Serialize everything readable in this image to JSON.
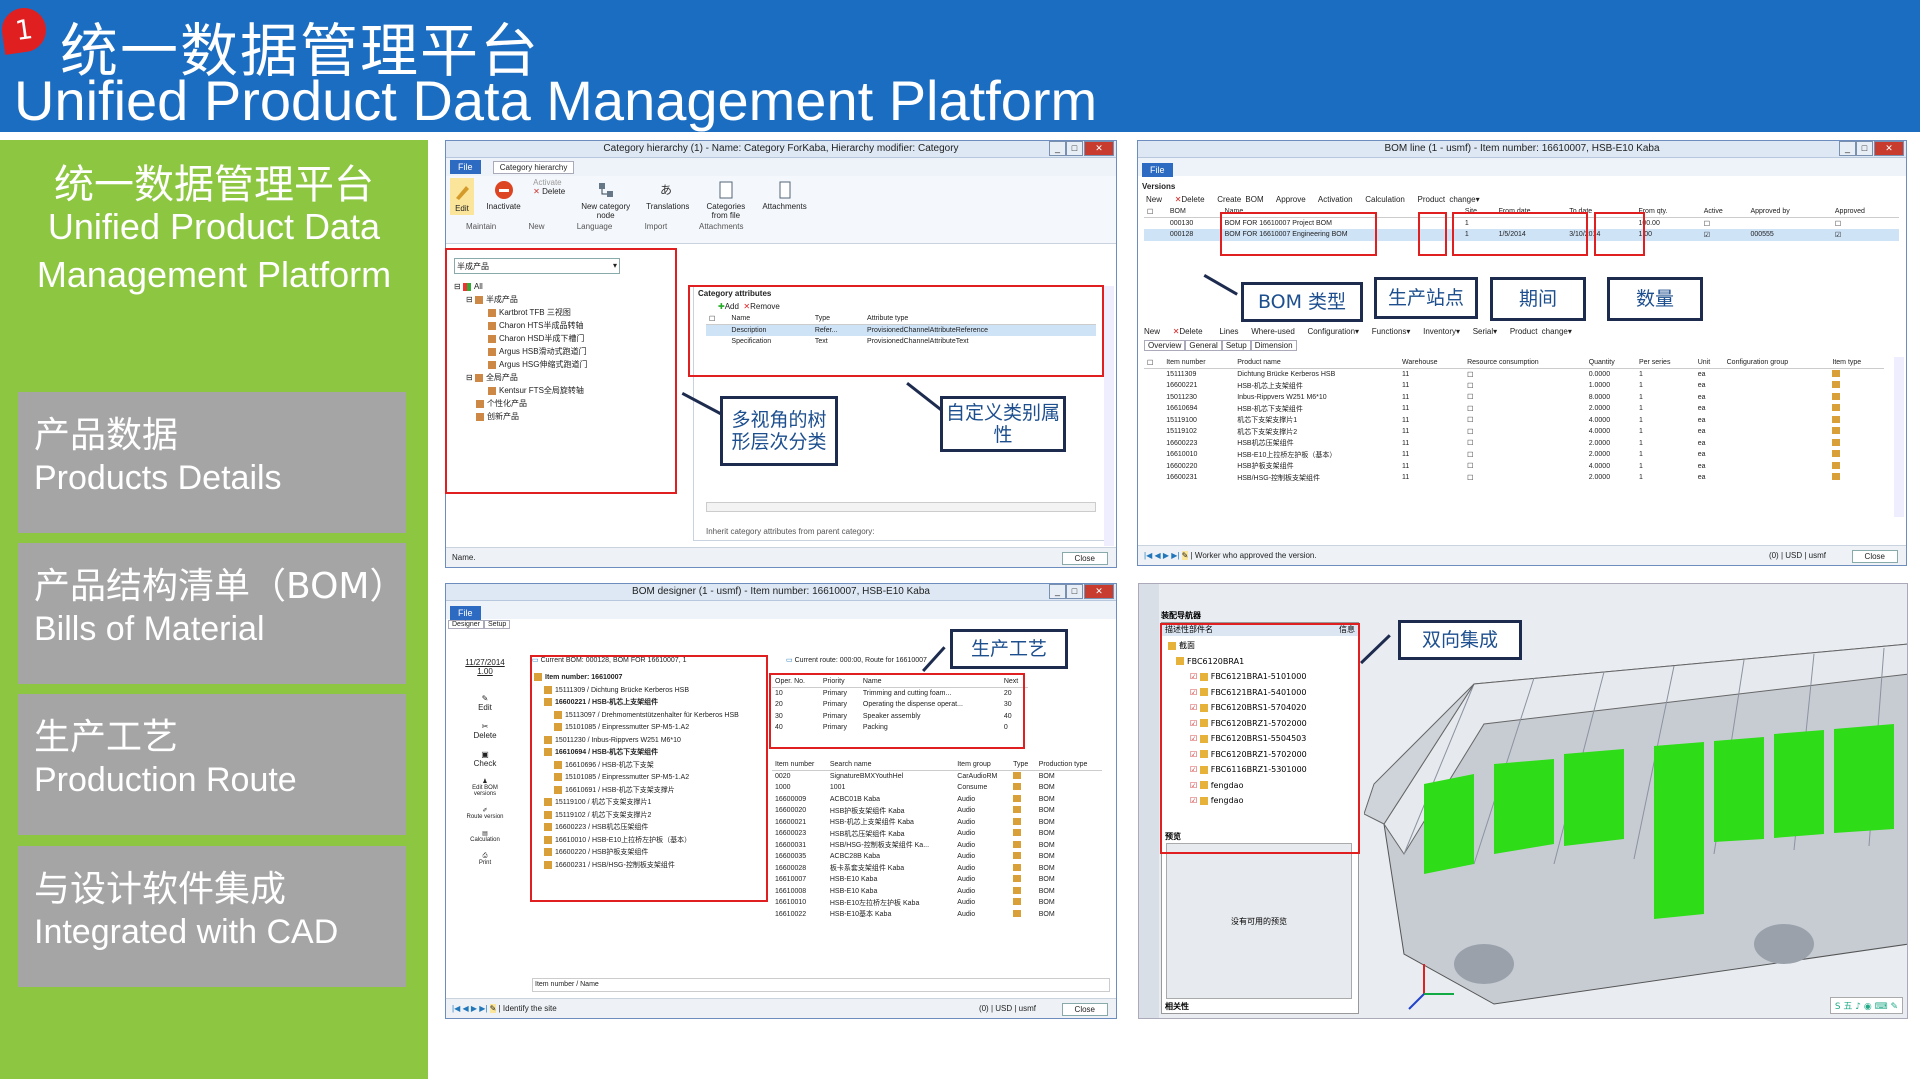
{
  "header": {
    "badge": "1",
    "title_cn": "统一数据管理平台",
    "title_en": "Unified Product Data Management Platform",
    "bg": "#1b6dc1"
  },
  "left": {
    "title_cn": "统一数据管理平台",
    "title_en1": "Unified Product Data",
    "title_en2": "Management Platform",
    "modules": [
      {
        "cn": "产品数据",
        "en": "Products Details"
      },
      {
        "cn": "产品结构清单（BOM）",
        "en": "Bills of Material"
      },
      {
        "cn": "生产工艺",
        "en": "Production Route"
      },
      {
        "cn": "与设计软件集成",
        "en": "Integrated with CAD"
      }
    ]
  },
  "w1": {
    "title": "Category hierarchy (1) - Name: Category ForKaba, Hierarchy modifier: Category",
    "file": "File",
    "tab": "Category hierarchy",
    "buttons": [
      "Edit",
      "Inactivate",
      "Activate",
      "Delete",
      "New category node",
      "Translations",
      "Categories from file",
      "Attachments"
    ],
    "groups": [
      "Maintain",
      "New",
      "Language",
      "Import",
      "Attachments"
    ],
    "select": "半成产品",
    "tree": [
      "All",
      "半成产品",
      "Kartbrot TFB 三视图",
      "Charon HTS半成品转轴",
      "Charon HSD半成下槽门",
      "Argus HSB滑动式跑道门",
      "Argus HSG伸缩式跑道门",
      "全局产品",
      "Kentsur FTS全局旋转轴",
      "个性化产品",
      "创新产品"
    ],
    "attr_title": "Category attributes",
    "add": "Add",
    "remove": "Remove",
    "cols": [
      "Name",
      "Type",
      "Attribute type"
    ],
    "rows": [
      [
        "Description",
        "Refer...",
        "ProvisionedChannelAttributeReference"
      ],
      [
        "Specification",
        "Text",
        "ProvisionedChannelAttributeText"
      ]
    ],
    "inherit": "Inherit category attributes from parent category:",
    "status": "Name.",
    "close": "Close",
    "callout1": "多视角的树形层次分类",
    "callout2": "自定义类别属性"
  },
  "w2": {
    "title": "BOM line (1 - usmf) - Item number: 16610007, HSB-E10 Kaba",
    "file": "File",
    "versions": "Versions",
    "toolbar": [
      "New",
      "Delete",
      "Create BOM",
      "Approve",
      "Activation",
      "Calculation",
      "Product change"
    ],
    "vcols": [
      "BOM",
      "Name",
      "Site",
      "From date",
      "To date",
      "From qty.",
      "Active",
      "Approved by",
      "Approved"
    ],
    "vrows": [
      [
        "000130",
        "BOM FOR 16610007 Project BOM",
        "1",
        "",
        "",
        "100.00",
        "",
        "",
        ""
      ],
      [
        "000128",
        "BOM FOR 16610007 Engineering BOM",
        "1",
        "1/5/2014",
        "3/10/2014",
        "1.00",
        "",
        "000555",
        ""
      ]
    ],
    "callouts": [
      "BOM 类型",
      "生产站点",
      "期间",
      "数量"
    ],
    "toolbar2": [
      "New",
      "Delete",
      "Lines",
      "Where-used",
      "Configuration",
      "Functions",
      "Inventory",
      "Serial",
      "Product change"
    ],
    "tabs": [
      "Overview",
      "General",
      "Setup",
      "Dimension"
    ],
    "lcols": [
      "Item number",
      "Product name",
      "Warehouse",
      "Resource consumption",
      "Quantity",
      "Per series",
      "Unit",
      "Configuration group",
      "Item type"
    ],
    "lrows": [
      [
        "15111309",
        "Dichtung Brücke Kerberos HSB",
        "11",
        "0.0000",
        "1",
        "ea"
      ],
      [
        "16600221",
        "HSB-机芯上支架组件",
        "11",
        "1.0000",
        "1",
        "ea"
      ],
      [
        "15011230",
        "Inbus-Rippvers W251 M6*10",
        "11",
        "8.0000",
        "1",
        "ea"
      ],
      [
        "16610694",
        "HSB-机芯下支架组件",
        "11",
        "2.0000",
        "1",
        "ea"
      ],
      [
        "15119100",
        "机芯下支架支撑片1",
        "11",
        "4.0000",
        "1",
        "ea"
      ],
      [
        "15119102",
        "机芯下支架支撑片2",
        "11",
        "4.0000",
        "1",
        "ea"
      ],
      [
        "16600223",
        "HSB机芯压架组件",
        "11",
        "2.0000",
        "1",
        "ea"
      ],
      [
        "16610010",
        "HSB-E10上拉桥左护板（基本）",
        "11",
        "2.0000",
        "1",
        "ea"
      ],
      [
        "16600220",
        "HSB护板支架组件",
        "11",
        "4.0000",
        "1",
        "ea"
      ],
      [
        "16600231",
        "HSB/HSG-控制板支架组件",
        "11",
        "2.0000",
        "1",
        "ea"
      ]
    ],
    "status": "Worker who approved the version.",
    "status_r": "(0) | USD | usmf",
    "close": "Close"
  },
  "w3": {
    "title": "BOM designer (1 - usmf) - Item number: 16610007, HSB-E10 Kaba",
    "file": "File",
    "tabs": [
      "Designer",
      "Setup"
    ],
    "date": "11/27/2014",
    "qty": "1.00",
    "side": [
      "Edit",
      "Delete",
      "Check",
      "Edit BOM versions",
      "Route version",
      "Calculation",
      "Print"
    ],
    "curbom": "Current BOM: 000128, BOM FOR 16610007, 1",
    "curroute": "Current route: 000:00, Route for 16610007",
    "tree": [
      "Item number: 16610007",
      "15111309 / Dichtung Brücke Kerberos HSB",
      "16600221 / HSB-机芯上支架组件",
      "15113097 / Drehmomentstützenhalter für Kerberos HSB",
      "15101085 / Einpressmutter SP-M5-1.A2",
      "15011230 / Inbus-Rippvers W251 M6*10",
      "16610694 / HSB-机芯下支架组件",
      "16610696 / HSB-机芯下支架",
      "15101085 / Einpressmutter SP-M5-1.A2",
      "16610691 / HSB-机芯下支架支撑片",
      "15119100 / 机芯下支架支撑片1",
      "15119102 / 机芯下支架支撑片2",
      "16600223 / HSB机芯压架组件",
      "16610010 / HSB-E10上拉桥左护板（基本）",
      "16600220 / HSB护板支架组件",
      "16600231 / HSB/HSG-控制板支架组件"
    ],
    "rcols": [
      "Oper. No.",
      "Priority",
      "Name",
      "Next"
    ],
    "rrows": [
      [
        "10",
        "Primary",
        "Trimming and cutting foam...",
        "20"
      ],
      [
        "20",
        "Primary",
        "Operating the dispense operat...",
        "30"
      ],
      [
        "30",
        "Primary",
        "Speaker assembly",
        "40"
      ],
      [
        "40",
        "Primary",
        "Packing",
        "0"
      ]
    ],
    "icols": [
      "Item number",
      "Search name",
      "Item group",
      "Type",
      "Production type"
    ],
    "irows": [
      [
        "0020",
        "SignatureBMXYouthHel",
        "CarAudioRM",
        "",
        "BOM"
      ],
      [
        "1000",
        "1001",
        "Consume",
        "",
        "BOM"
      ],
      [
        "16600009",
        "ACBC01B Kaba",
        "Audio",
        "",
        "BOM"
      ],
      [
        "16600020",
        "HSB护板支架组件 Kaba",
        "Audio",
        "",
        "BOM"
      ],
      [
        "16600021",
        "HSB-机芯上支架组件 Kaba",
        "Audio",
        "",
        "BOM"
      ],
      [
        "16600023",
        "HSB机芯压架组件 Kaba",
        "Audio",
        "",
        "BOM"
      ],
      [
        "16600031",
        "HSB/HSG-控制板支架组件 Ka...",
        "Audio",
        "",
        "BOM"
      ],
      [
        "16600035",
        "ACBC28B Kaba",
        "Audio",
        "",
        "BOM"
      ],
      [
        "16600028",
        "板卡系套支架组件 Kaba",
        "Audio",
        "",
        "BOM"
      ],
      [
        "16610007",
        "HSB-E10 Kaba",
        "Audio",
        "",
        "BOM"
      ],
      [
        "16610008",
        "HSB-E10 Kaba",
        "Audio",
        "",
        "BOM"
      ],
      [
        "16610010",
        "HSB-E10左拉桥左护板 Kaba",
        "Audio",
        "",
        "BOM"
      ],
      [
        "16610022",
        "HSB-E10基本 Kaba",
        "Audio",
        "",
        "BOM"
      ]
    ],
    "footer": "Item number / Name",
    "status": "Identify the site",
    "status_r": "(0) | USD | usmf",
    "close": "Close",
    "callout": "生产工艺"
  },
  "w4": {
    "panel_title": "装配导航器",
    "col1": "描述性部件名",
    "col2": "信息",
    "tree": [
      "截面",
      "FBC6120BRA1",
      "FBC6121BRA1-5101000",
      "FBC6121BRA1-5401000",
      "FBC6120BRS1-5704020",
      "FBC6120BRZ1-5702000",
      "FBC6120BRS1-5504503",
      "FBC6120BRZ1-5702000",
      "FBC6116BRZ1-5301000",
      "fengdao",
      "fengdao"
    ],
    "preview": "预览",
    "nopreview": "没有可用的预览",
    "related": "相关性",
    "callout": "双向集成",
    "ime": "五"
  }
}
